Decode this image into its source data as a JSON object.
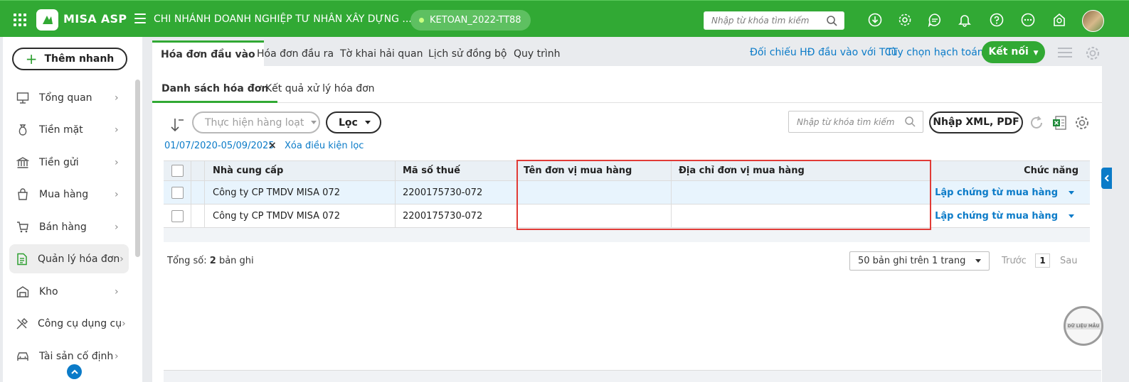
{
  "app": {
    "logo_text": "MISA ASP",
    "company_name": "CHI NHÁNH DOANH NGHIỆP TƯ NHÂN XÂY DỰNG ...",
    "database": "KETOAN_2022-TT88",
    "search_placeholder": "Nhập từ khóa tìm kiếm",
    "brand_color": "#31a934",
    "link_color": "#0b7bc8"
  },
  "sidebar": {
    "quick_add_label": "Thêm nhanh",
    "items": [
      {
        "label": "Tổng quan",
        "icon": "dashboard-icon"
      },
      {
        "label": "Tiền mặt",
        "icon": "money-bag-icon"
      },
      {
        "label": "Tiền gửi",
        "icon": "bank-icon"
      },
      {
        "label": "Mua hàng",
        "icon": "shopping-bag-icon"
      },
      {
        "label": "Bán hàng",
        "icon": "cart-icon"
      },
      {
        "label": "Quản lý hóa đơn",
        "icon": "invoice-icon"
      },
      {
        "label": "Kho",
        "icon": "warehouse-icon"
      },
      {
        "label": "Công cụ dụng cụ",
        "icon": "tools-icon"
      },
      {
        "label": "Tài sản cố định",
        "icon": "car-icon"
      }
    ],
    "active_index": 5
  },
  "tabs": {
    "items": [
      "Hóa đơn đầu vào",
      "Hóa đơn đầu ra",
      "Tờ khai hải quan",
      "Lịch sử đồng bộ",
      "Quy trình"
    ],
    "active_index": 0
  },
  "header_links": {
    "compare": "Đối chiếu HĐ đầu vào với TCT",
    "options": "Tùy chọn hạch toán",
    "connect": "Kết nối"
  },
  "subtabs": {
    "items": [
      "Danh sách hóa đơn",
      "Kết quả xử lý hóa đơn"
    ],
    "active_index": 0
  },
  "toolbar": {
    "batch_label": "Thực hiện hàng loạt",
    "filter_label": "Lọc",
    "search_placeholder": "Nhập từ khóa tìm kiếm",
    "import_label": "Nhập XML, PDF"
  },
  "filter": {
    "date_range": "01/07/2020-05/09/2025",
    "clear_label": "Xóa điều kiện lọc"
  },
  "table": {
    "columns": {
      "supplier": "Nhà cung cấp",
      "tax_code": "Mã số thuế",
      "buyer_name": "Tên đơn vị mua hàng",
      "buyer_address": "Địa chỉ đơn vị mua hàng",
      "actions": "Chức năng"
    },
    "rows": [
      {
        "supplier": "Công ty CP TMDV MISA 072",
        "tax_code": "2200175730-072",
        "buyer_name": "",
        "buyer_address": "",
        "action": "Lập chứng từ mua hàng"
      },
      {
        "supplier": "Công ty CP TMDV MISA 072",
        "tax_code": "2200175730-072",
        "buyer_name": "",
        "buyer_address": "",
        "action": "Lập chứng từ mua hàng"
      }
    ]
  },
  "footer": {
    "total_prefix": "Tổng số:",
    "total_count": "2",
    "total_suffix": "bản ghi",
    "page_size": "50 bản ghi trên 1 trang",
    "prev": "Trước",
    "page": "1",
    "next": "Sau"
  },
  "stamp": {
    "text": "DỮ LIỆU MẪU"
  }
}
